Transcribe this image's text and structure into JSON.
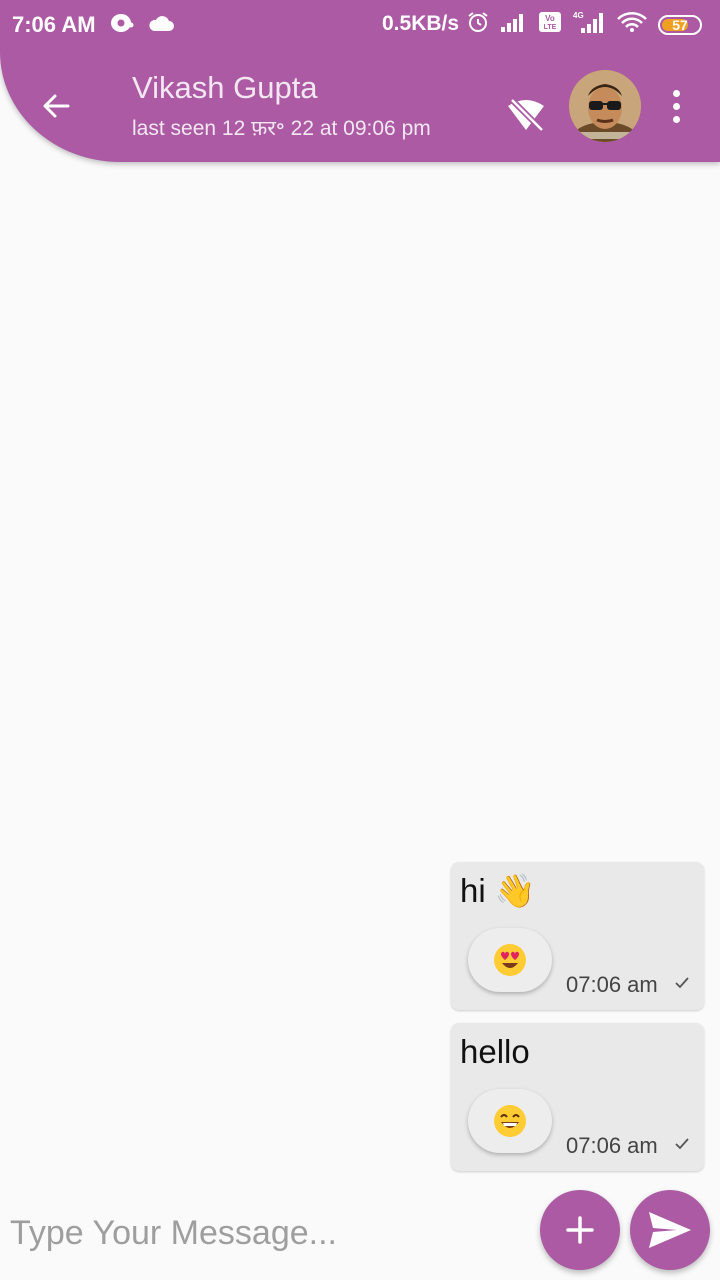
{
  "status_bar": {
    "time": "7:06 AM",
    "network_speed": "0.5KB/s",
    "battery": "57",
    "icons": [
      "sync-icon",
      "cloud-icon",
      "alarm-icon",
      "signal-icon",
      "volte-icon",
      "signal-4g-icon",
      "wifi-icon",
      "battery-icon"
    ]
  },
  "app_bar": {
    "contact_name": "Vikash Gupta",
    "last_seen": "last seen 12 फ़र॰ 22 at 09:06 pm",
    "icons": [
      "back-arrow-icon",
      "wifi-off-icon",
      "more-vert-icon"
    ],
    "accent_color": "#ab5aa3"
  },
  "messages": [
    {
      "text": "hi 👋",
      "reaction": "😍",
      "time": "07:06 am",
      "status": "sent"
    },
    {
      "text": "hello",
      "reaction": "😄",
      "time": "07:06 am",
      "status": "sent"
    }
  ],
  "composer": {
    "placeholder": "Type Your Message...",
    "value": "",
    "icons": [
      "add-icon",
      "send-icon"
    ]
  }
}
